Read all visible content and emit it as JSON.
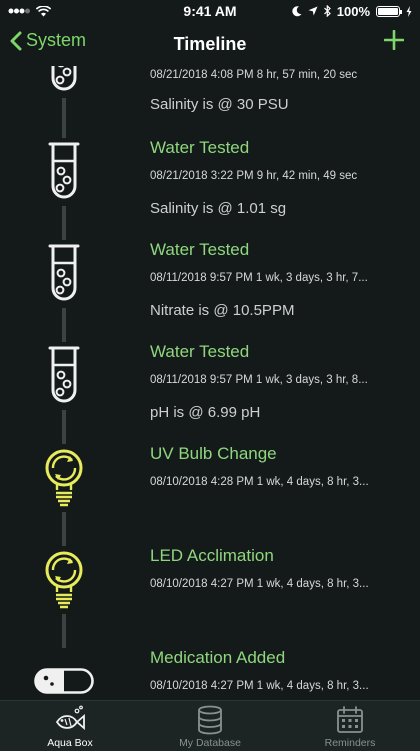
{
  "status_bar": {
    "time": "9:41 AM",
    "battery": "100%"
  },
  "nav": {
    "back_label": "System",
    "title": "Timeline",
    "add_icon": "plus-icon",
    "accent_color": "#7ed66a"
  },
  "entries": [
    {
      "icon": "test-tube-icon",
      "title": "",
      "time": "08/21/2018 4:08 PM 8 hr, 57 min, 20 sec",
      "detail": "Salinity is @ 30 PSU"
    },
    {
      "icon": "test-tube-icon",
      "title": "Water Tested",
      "time": "08/21/2018 3:22 PM 9 hr, 42 min, 49 sec",
      "detail": "Salinity is @ 1.01 sg"
    },
    {
      "icon": "test-tube-icon",
      "title": "Water Tested",
      "time": "08/11/2018 9:57 PM 1 wk, 3 days, 3 hr, 7...",
      "detail": "Nitrate is @ 10.5PPM"
    },
    {
      "icon": "test-tube-icon",
      "title": "Water Tested",
      "time": "08/11/2018 9:57 PM 1 wk, 3 days, 3 hr, 8...",
      "detail": "pH is @ 6.99 pH"
    },
    {
      "icon": "light-bulb-icon",
      "title": "UV Bulb Change",
      "time": "08/10/2018 4:28 PM 1 wk, 4 days, 8 hr, 3...",
      "detail": ""
    },
    {
      "icon": "light-bulb-icon",
      "title": "LED Acclimation",
      "time": "08/10/2018 4:27 PM 1 wk, 4 days, 8 hr, 3...",
      "detail": ""
    },
    {
      "icon": "pill-icon",
      "title": "Medication Added",
      "time": "08/10/2018 4:27 PM 1 wk, 4 days, 8 hr, 3...",
      "detail": ""
    }
  ],
  "tabs": [
    {
      "label": "Aqua Box",
      "icon": "fish-icon",
      "active": true
    },
    {
      "label": "My Database",
      "icon": "database-icon",
      "active": false
    },
    {
      "label": "Reminders",
      "icon": "calendar-icon",
      "active": false
    }
  ]
}
